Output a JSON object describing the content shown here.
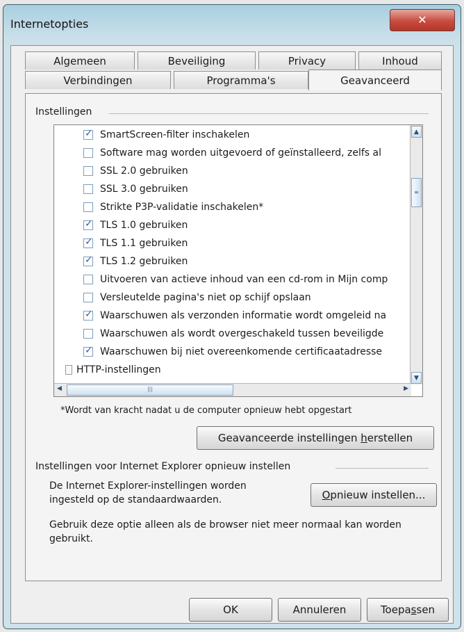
{
  "window": {
    "title": "Internetopties",
    "close_glyph": "✕"
  },
  "tabs": {
    "row1": [
      "Algemeen",
      "Beveiliging",
      "Privacy",
      "Inhoud"
    ],
    "row2": [
      "Verbindingen",
      "Programma's",
      "Geavanceerd"
    ],
    "active": "Geavanceerd"
  },
  "settings": {
    "group_label": "Instellingen",
    "items": [
      {
        "label": "SmartScreen-filter inschakelen",
        "checked": true
      },
      {
        "label": "Software mag worden uitgevoerd of geïnstalleerd, zelfs al",
        "checked": false
      },
      {
        "label": "SSL 2.0 gebruiken",
        "checked": false
      },
      {
        "label": "SSL 3.0 gebruiken",
        "checked": false
      },
      {
        "label": "Strikte P3P-validatie inschakelen*",
        "checked": false
      },
      {
        "label": "TLS 1.0 gebruiken",
        "checked": true
      },
      {
        "label": "TLS 1.1 gebruiken",
        "checked": true
      },
      {
        "label": "TLS 1.2 gebruiken",
        "checked": true
      },
      {
        "label": "Uitvoeren van actieve inhoud van een cd-rom in Mijn comp",
        "checked": false
      },
      {
        "label": "Versleutelde pagina's niet op schijf opslaan",
        "checked": false
      },
      {
        "label": "Waarschuwen als verzonden informatie wordt omgeleid na",
        "checked": true
      },
      {
        "label": "Waarschuwen als wordt overgeschakeld tussen beveiligde",
        "checked": false
      },
      {
        "label": "Waarschuwen bij niet overeenkomende certificaatadresse",
        "checked": true
      }
    ],
    "section_header": "HTTP-instellingen",
    "note": "*Wordt van kracht nadat u de computer opnieuw hebt opgestart",
    "restore_button": {
      "pre": "Geavanceerde instellingen ",
      "accel": "h",
      "post": "erstellen"
    }
  },
  "reset_group": {
    "label": "Instellingen voor Internet Explorer opnieuw instellen",
    "description": "De Internet Explorer-instellingen worden ingesteld op de standaardwaarden.",
    "reset_button": {
      "accel": "O",
      "post": "pnieuw instellen..."
    },
    "hint": "Gebruik deze optie alleen als de browser niet meer normaal kan worden gebruikt."
  },
  "footer": {
    "ok": "OK",
    "cancel": "Annuleren",
    "apply": {
      "pre": "Toepa",
      "accel": "s",
      "post": "sen"
    }
  },
  "icons": {
    "scroll_up": "▲",
    "scroll_down": "▼",
    "scroll_left": "◀",
    "scroll_right": "▶",
    "grip_v": "≡",
    "grip_h": "|||"
  }
}
